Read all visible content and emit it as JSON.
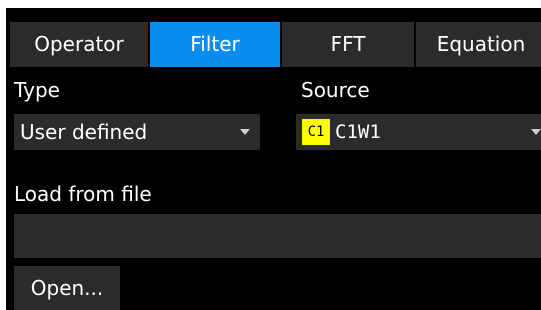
{
  "tabs": [
    {
      "label": "Operator",
      "active": false
    },
    {
      "label": "Filter",
      "active": true
    },
    {
      "label": "FFT",
      "active": false
    },
    {
      "label": "Equation",
      "active": false
    }
  ],
  "type_field": {
    "label": "Type",
    "value": "User defined",
    "icon": "chevron-down-icon"
  },
  "source_field": {
    "label": "Source",
    "badge": "C1",
    "value": "C1W1",
    "badge_color": "#ffff00",
    "icon": "chevron-down-icon"
  },
  "load_field": {
    "label": "Load from file",
    "value": "",
    "placeholder": ""
  },
  "open_button": {
    "label": "Open..."
  },
  "colors": {
    "background": "#000000",
    "control": "#2b2b2b",
    "active_tab": "#0a8df0",
    "text": "#ffffff"
  }
}
